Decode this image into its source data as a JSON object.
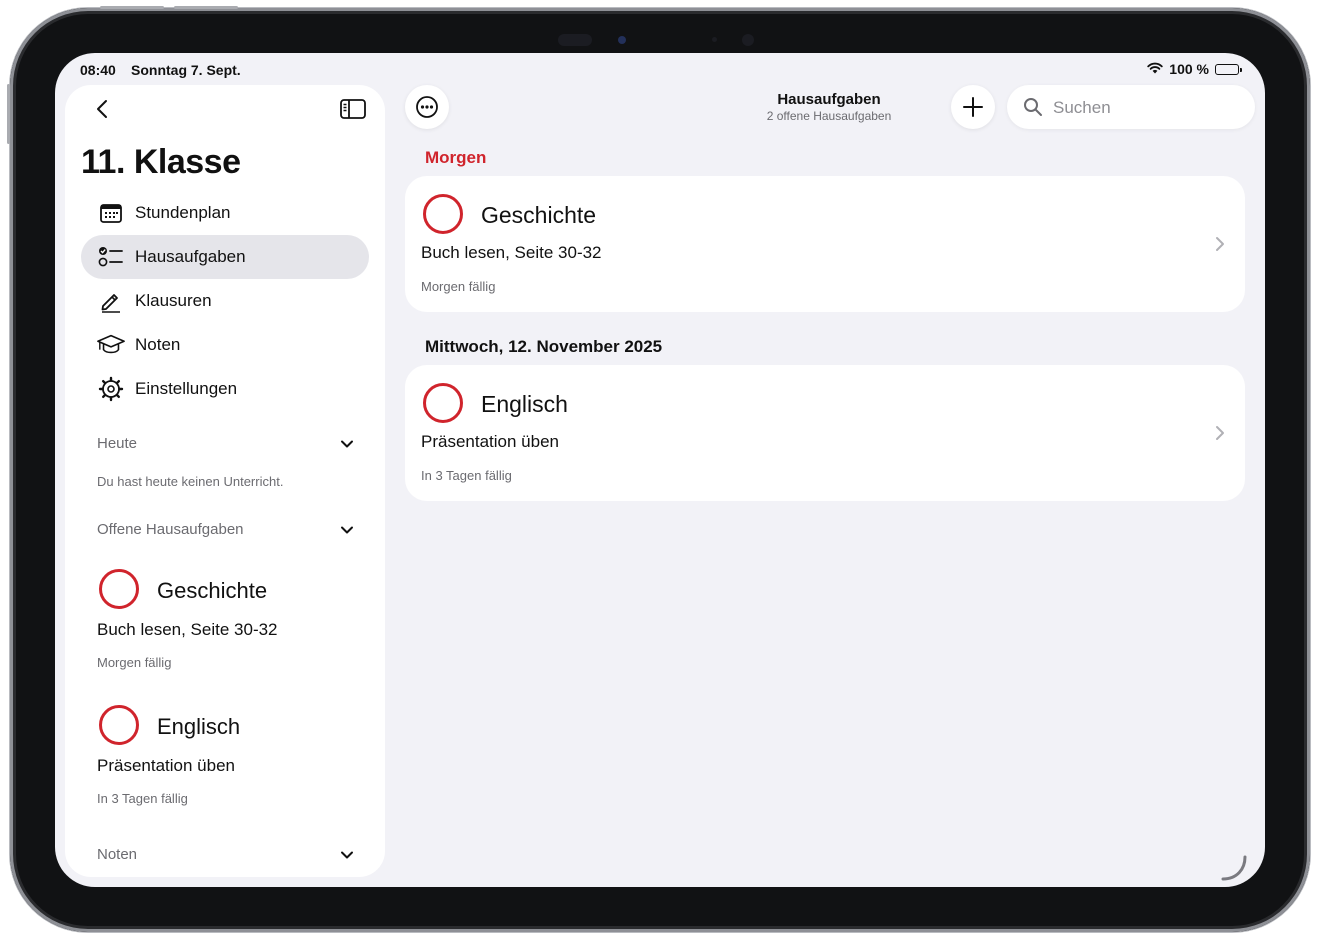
{
  "status": {
    "time": "08:40",
    "date": "Sonntag 7. Sept.",
    "battery": "100 %"
  },
  "sidebar": {
    "title": "11. Klasse",
    "nav": [
      {
        "label": "Stundenplan",
        "icon": "calendar-icon",
        "active": false
      },
      {
        "label": "Hausaufgaben",
        "icon": "checklist-icon",
        "active": true
      },
      {
        "label": "Klausuren",
        "icon": "pencil-icon",
        "active": false
      },
      {
        "label": "Noten",
        "icon": "graduation-cap-icon",
        "active": false
      },
      {
        "label": "Einstellungen",
        "icon": "gear-icon",
        "active": false
      }
    ],
    "today": {
      "label": "Heute",
      "note": "Du hast heute keinen Unterricht."
    },
    "open_homework": {
      "label": "Offene Hausaufgaben",
      "items": [
        {
          "subject": "Geschichte",
          "description": "Buch lesen, Seite 30-32",
          "due": "Morgen fällig"
        },
        {
          "subject": "Englisch",
          "description": "Präsentation üben",
          "due": "In 3 Tagen fällig"
        }
      ]
    },
    "grades": {
      "label": "Noten"
    }
  },
  "header": {
    "title": "Hausaufgaben",
    "subtitle": "2 offene Hausaufgaben",
    "search_placeholder": "Suchen"
  },
  "groups": [
    {
      "label": "Morgen",
      "label_color": "#d0242c",
      "items": [
        {
          "subject": "Geschichte",
          "description": "Buch lesen, Seite 30-32",
          "due": "Morgen fällig"
        }
      ]
    },
    {
      "label": "Mittwoch, 12. November 2025",
      "label_color": "#111111",
      "items": [
        {
          "subject": "Englisch",
          "description": "Präsentation üben",
          "due": "In 3 Tagen fällig"
        }
      ]
    }
  ],
  "colors": {
    "accent": "#d0242c",
    "background": "#f2f2f7"
  }
}
